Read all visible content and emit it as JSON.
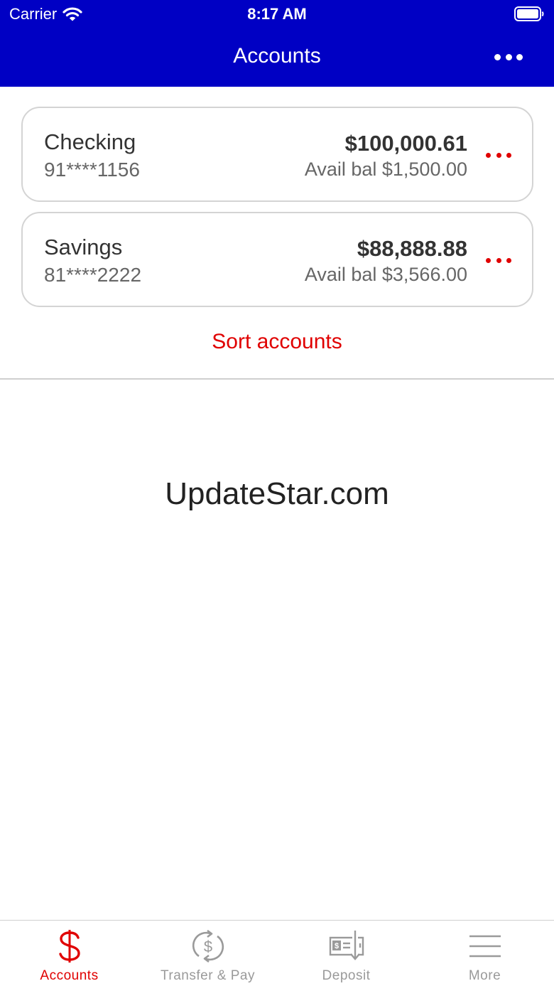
{
  "status_bar": {
    "carrier": "Carrier",
    "time": "8:17 AM"
  },
  "nav": {
    "title": "Accounts",
    "more_icon": "more-horizontal-icon"
  },
  "accounts": [
    {
      "name": "Checking",
      "number": "91****1156",
      "balance": "$100,000.61",
      "available": "Avail bal $1,500.00"
    },
    {
      "name": "Savings",
      "number": "81****2222",
      "balance": "$88,888.88",
      "available": "Avail bal $3,566.00"
    }
  ],
  "sort_label": "Sort accounts",
  "watermark": "UpdateStar.com",
  "tabs": [
    {
      "label": "Accounts",
      "icon": "dollar-icon",
      "active": true
    },
    {
      "label": "Transfer & Pay",
      "icon": "transfer-icon",
      "active": false
    },
    {
      "label": "Deposit",
      "icon": "check-deposit-icon",
      "active": false
    },
    {
      "label": "More",
      "icon": "menu-icon",
      "active": false
    }
  ],
  "colors": {
    "header_bg": "#0000c4",
    "accent": "#e00000",
    "inactive": "#9a9a9a"
  }
}
